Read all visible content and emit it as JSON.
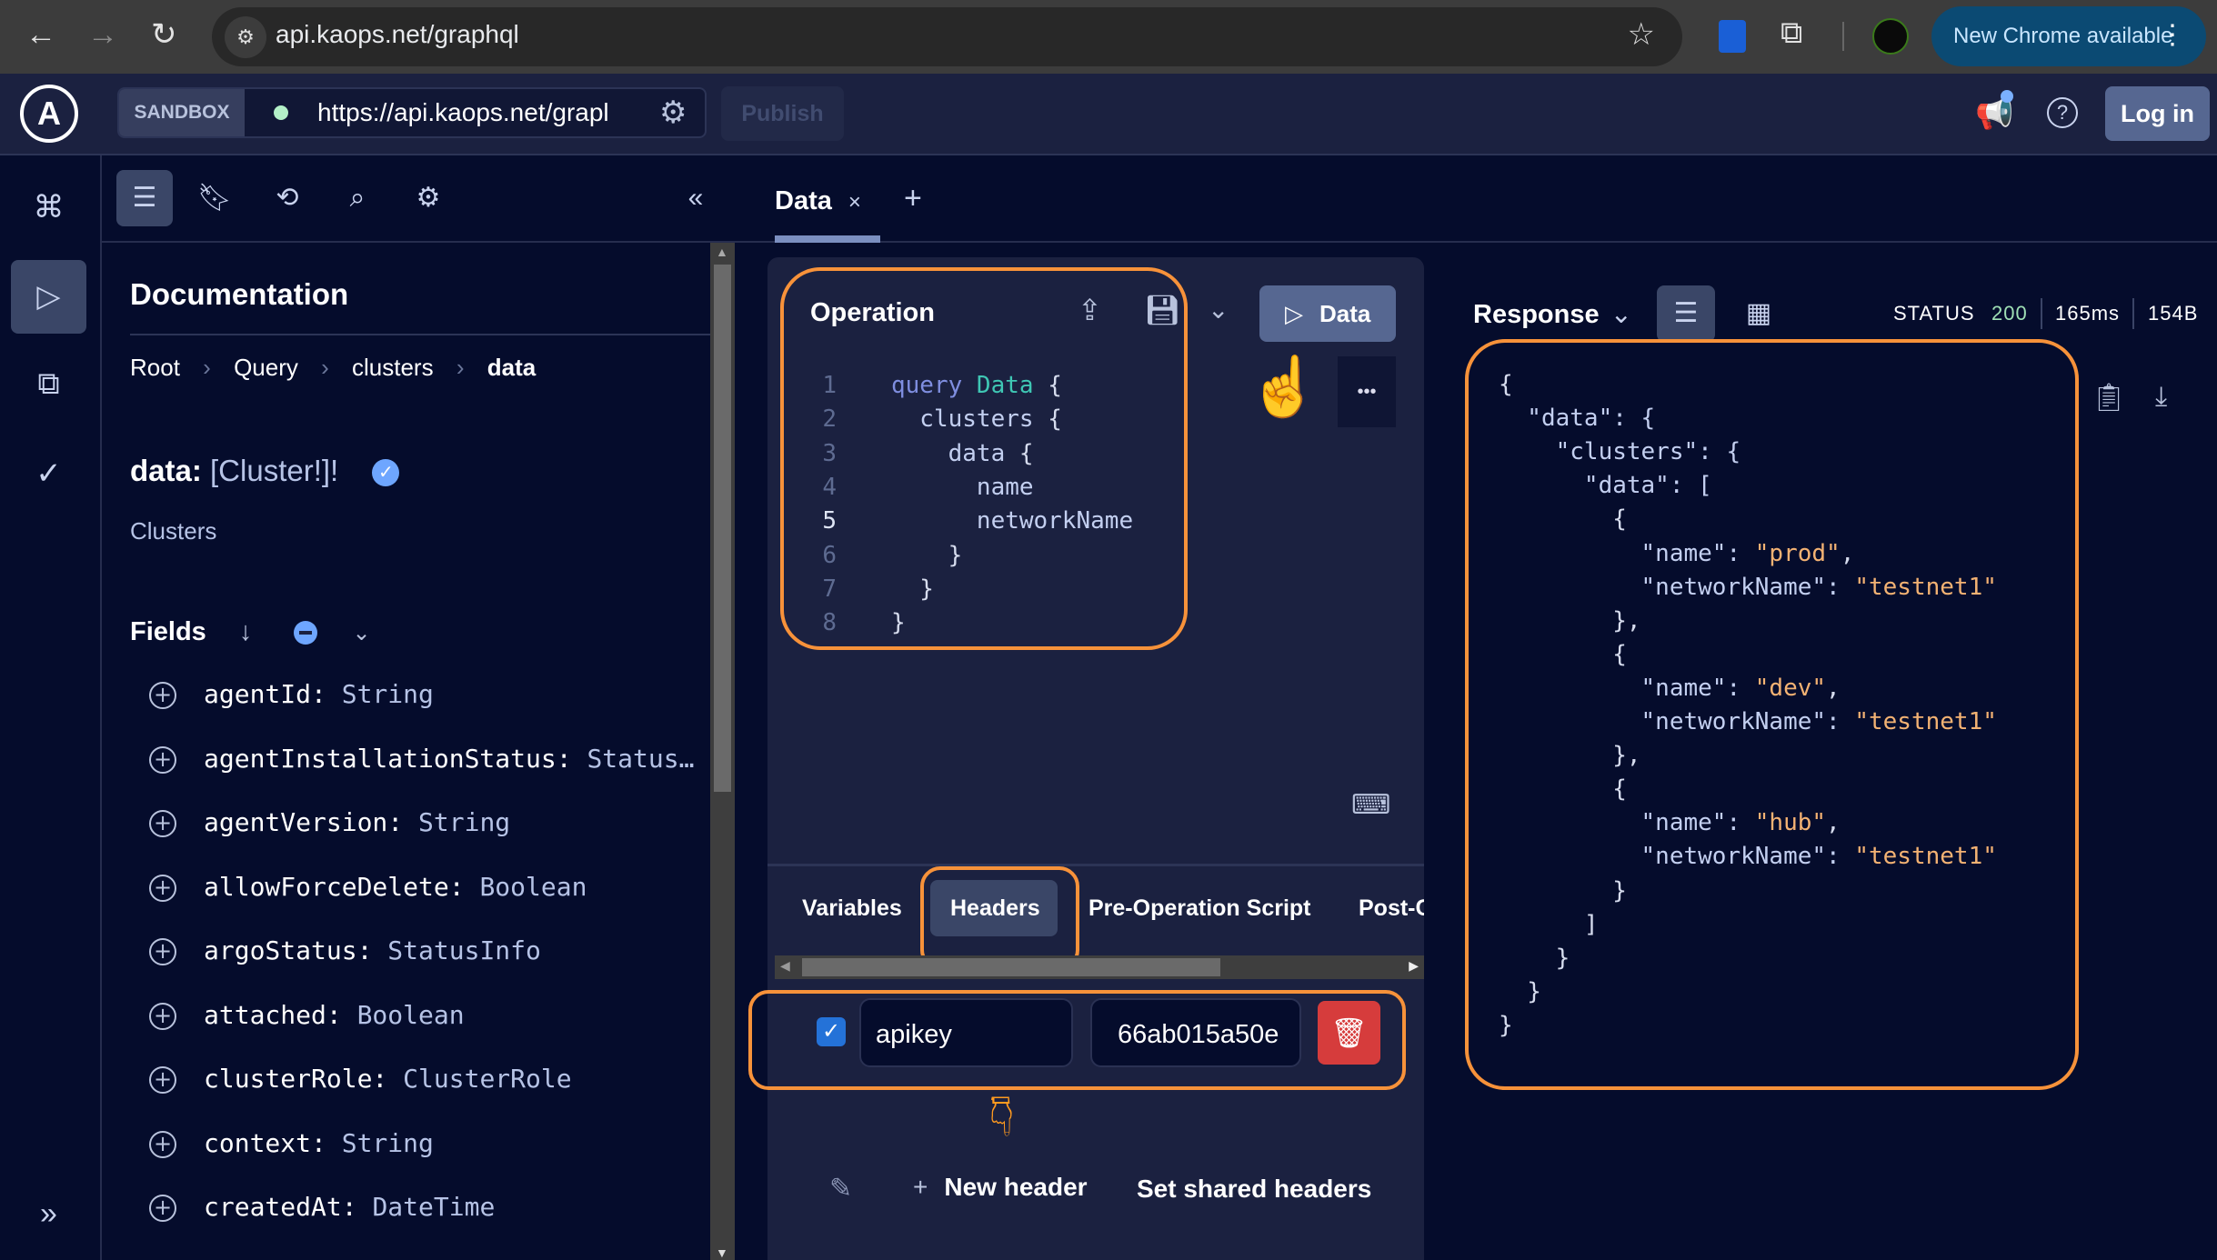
{
  "browser": {
    "url": "api.kaops.net/graphql",
    "update_label": "New Chrome available"
  },
  "header": {
    "sandbox_label": "SANDBOX",
    "endpoint": "https://api.kaops.net/grapl",
    "publish_label": "Publish",
    "login_label": "Log in"
  },
  "tabs": [
    {
      "label": "Data",
      "close": "×"
    }
  ],
  "add_tab": "+",
  "docs": {
    "title": "Documentation",
    "breadcrumb": [
      "Root",
      "Query",
      "clusters",
      "data"
    ],
    "field_name": "data:",
    "field_type": "[Cluster!]!",
    "description": "Clusters",
    "fields_label": "Fields",
    "fields": [
      {
        "name": "agentId:",
        "type": "String"
      },
      {
        "name": "agentInstallationStatus:",
        "type": "Status…"
      },
      {
        "name": "agentVersion:",
        "type": "String"
      },
      {
        "name": "allowForceDelete:",
        "type": "Boolean"
      },
      {
        "name": "argoStatus:",
        "type": "StatusInfo"
      },
      {
        "name": "attached:",
        "type": "Boolean"
      },
      {
        "name": "clusterRole:",
        "type": "ClusterRole"
      },
      {
        "name": "context:",
        "type": "String"
      },
      {
        "name": "createdAt:",
        "type": "DateTime"
      }
    ]
  },
  "operation": {
    "title": "Operation",
    "run_label": "Data",
    "more_label": "•••",
    "lines": [
      [
        {
          "t": "query ",
          "c": "kw"
        },
        {
          "t": "Data ",
          "c": "tp"
        },
        {
          "t": "{",
          "c": "pn"
        }
      ],
      [
        {
          "t": "  clusters ",
          "c": "fd"
        },
        {
          "t": "{",
          "c": "pn"
        }
      ],
      [
        {
          "t": "    data ",
          "c": "fd"
        },
        {
          "t": "{",
          "c": "pn"
        }
      ],
      [
        {
          "t": "      name",
          "c": "fd"
        }
      ],
      [
        {
          "t": "      networkName",
          "c": "fd"
        }
      ],
      [
        {
          "t": "    }",
          "c": "pn"
        }
      ],
      [
        {
          "t": "  }",
          "c": "pn"
        }
      ],
      [
        {
          "t": "}",
          "c": "pn"
        }
      ]
    ]
  },
  "bottom_tabs": [
    "Variables",
    "Headers",
    "Pre-Operation Script",
    "Post-C"
  ],
  "active_bottom_tab": "Headers",
  "headers": [
    {
      "enabled": true,
      "key": "apikey",
      "value": "66ab015a50e"
    }
  ],
  "new_header_label": "New header",
  "shared_headers_label": "Set shared headers",
  "response": {
    "title": "Response",
    "status_label": "STATUS",
    "status_code": "200",
    "time": "165ms",
    "size": "154B",
    "lines": [
      [
        {
          "t": "{",
          "c": "pn"
        }
      ],
      [
        {
          "t": "  \"data\": {",
          "c": "fd"
        }
      ],
      [
        {
          "t": "    \"clusters\": {",
          "c": "fd"
        }
      ],
      [
        {
          "t": "      \"data\": [",
          "c": "fd"
        }
      ],
      [
        {
          "t": "        {",
          "c": "pn"
        }
      ],
      [
        {
          "t": "          \"name\": ",
          "c": "fd"
        },
        {
          "t": "\"prod\"",
          "c": "st"
        },
        {
          "t": ",",
          "c": "pn"
        }
      ],
      [
        {
          "t": "          \"networkName\": ",
          "c": "fd"
        },
        {
          "t": "\"testnet1\"",
          "c": "st"
        }
      ],
      [
        {
          "t": "        },",
          "c": "pn"
        }
      ],
      [
        {
          "t": "        {",
          "c": "pn"
        }
      ],
      [
        {
          "t": "          \"name\": ",
          "c": "fd"
        },
        {
          "t": "\"dev\"",
          "c": "st"
        },
        {
          "t": ",",
          "c": "pn"
        }
      ],
      [
        {
          "t": "          \"networkName\": ",
          "c": "fd"
        },
        {
          "t": "\"testnet1\"",
          "c": "st"
        }
      ],
      [
        {
          "t": "        },",
          "c": "pn"
        }
      ],
      [
        {
          "t": "        {",
          "c": "pn"
        }
      ],
      [
        {
          "t": "          \"name\": ",
          "c": "fd"
        },
        {
          "t": "\"hub\"",
          "c": "st"
        },
        {
          "t": ",",
          "c": "pn"
        }
      ],
      [
        {
          "t": "          \"networkName\": ",
          "c": "fd"
        },
        {
          "t": "\"testnet1\"",
          "c": "st"
        }
      ],
      [
        {
          "t": "        }",
          "c": "pn"
        }
      ],
      [
        {
          "t": "      ]",
          "c": "pn"
        }
      ],
      [
        {
          "t": "    }",
          "c": "pn"
        }
      ],
      [
        {
          "t": "  }",
          "c": "pn"
        }
      ],
      [
        {
          "t": "}",
          "c": "pn"
        }
      ]
    ]
  },
  "colors": {
    "accent_orange": "#f7923a",
    "run_button": "#566791",
    "status_ok": "#9fe0b5",
    "delete": "#d63c3c",
    "checkbox": "#2472d8"
  }
}
